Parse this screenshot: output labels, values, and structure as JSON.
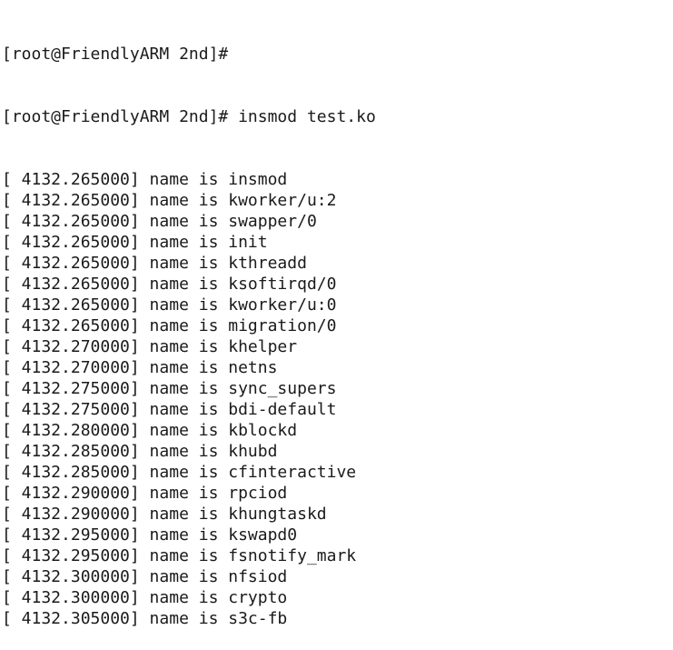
{
  "terminal": {
    "prompt_lines": [
      "[root@FriendlyARM 2nd]#",
      "[root@FriendlyARM 2nd]# insmod test.ko"
    ],
    "log_lines": [
      "[ 4132.265000] name is insmod",
      "[ 4132.265000] name is kworker/u:2",
      "[ 4132.265000] name is swapper/0",
      "[ 4132.265000] name is init",
      "[ 4132.265000] name is kthreadd",
      "[ 4132.265000] name is ksoftirqd/0",
      "[ 4132.265000] name is kworker/u:0",
      "[ 4132.265000] name is migration/0",
      "[ 4132.270000] name is khelper",
      "[ 4132.270000] name is netns",
      "[ 4132.275000] name is sync_supers",
      "[ 4132.275000] name is bdi-default",
      "[ 4132.280000] name is kblockd",
      "[ 4132.285000] name is khubd",
      "[ 4132.285000] name is cfinteractive",
      "[ 4132.290000] name is rpciod",
      "[ 4132.290000] name is khungtaskd",
      "[ 4132.295000] name is kswapd0",
      "[ 4132.295000] name is fsnotify_mark",
      "[ 4132.300000] name is nfsiod",
      "[ 4132.300000] name is crypto",
      "[ 4132.305000] name is s3c-fb"
    ]
  }
}
